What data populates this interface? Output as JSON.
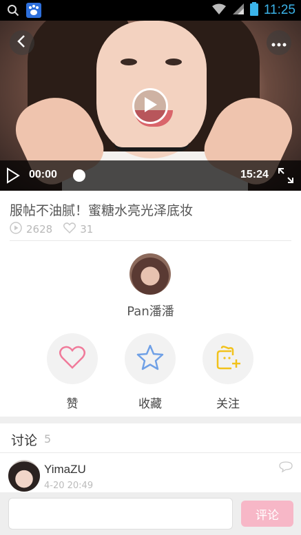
{
  "status_bar": {
    "time": "11:25",
    "time_color": "#3bb4ea"
  },
  "video": {
    "current_time": "00:00",
    "total_time": "15:24"
  },
  "post": {
    "title": "服帖不油腻！蜜糖水亮光泽底妆",
    "plays": "2628",
    "likes": "31"
  },
  "author": {
    "name": "Pan潘潘"
  },
  "actions": [
    {
      "label": "赞",
      "icon": "heart-icon",
      "color": "#f07a9a"
    },
    {
      "label": "收藏",
      "icon": "star-icon",
      "color": "#6fa0e6"
    },
    {
      "label": "关注",
      "icon": "follow-icon",
      "color": "#f2c21b"
    }
  ],
  "discussion": {
    "title": "讨论",
    "count": "5",
    "comments": [
      {
        "user": "YimaZU",
        "date": "4-20  20:49"
      }
    ]
  },
  "composer": {
    "placeholder": "",
    "send_label": "评论",
    "send_color": "#f7b7c7"
  }
}
